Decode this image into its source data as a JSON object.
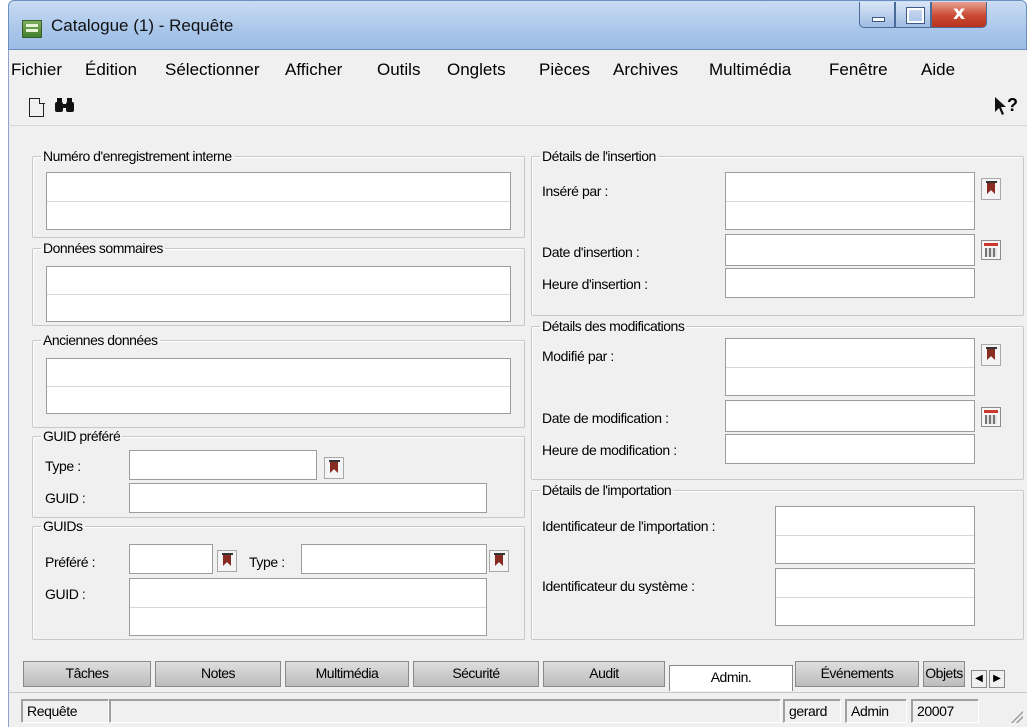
{
  "window": {
    "title": "Catalogue (1) - Requête"
  },
  "menu": [
    "Fichier",
    "Édition",
    "Sélectionner",
    "Afficher",
    "Outils",
    "Onglets",
    "Pièces",
    "Archives",
    "Multimédia",
    "Fenêtre",
    "Aide"
  ],
  "toolbar": {
    "new_icon": "new-document-icon",
    "find_icon": "binoculars-icon",
    "help_icon": "context-help-icon",
    "help_glyph": "?"
  },
  "left": {
    "numero": {
      "legend": "Numéro d'enregistrement interne",
      "value": ""
    },
    "donnees": {
      "legend": "Données sommaires",
      "value": ""
    },
    "anciennes": {
      "legend": "Anciennes données",
      "value": ""
    },
    "guid_prefere": {
      "legend": "GUID préféré",
      "type_label": "Type :",
      "type_value": "",
      "guid_label": "GUID :",
      "guid_value": ""
    },
    "guids": {
      "legend": "GUIDs",
      "prefere_label": "Préféré :",
      "prefere_value": "",
      "type_label": "Type :",
      "type_value": "",
      "guid_label": "GUID :",
      "guid_value": ""
    }
  },
  "right": {
    "insertion": {
      "legend": "Détails de l'insertion",
      "insere_par": "Inséré par :",
      "date": "Date d'insertion :",
      "heure": "Heure d'insertion :"
    },
    "modifications": {
      "legend": "Détails des modifications",
      "modifie_par": "Modifié par :",
      "date": "Date de modification :",
      "heure": "Heure de modification :"
    },
    "importation": {
      "legend": "Détails de l'importation",
      "ident_import": "Identificateur de l'importation :",
      "ident_systeme": "Identificateur du système :"
    }
  },
  "tabs": [
    "Tâches",
    "Notes",
    "Multimédia",
    "Sécurité",
    "Audit",
    "Admin.",
    "Événements",
    "Objets"
  ],
  "active_tab": "Admin.",
  "status": {
    "mode": "Requête",
    "user": "gerard",
    "role": "Admin",
    "code": "20007"
  }
}
